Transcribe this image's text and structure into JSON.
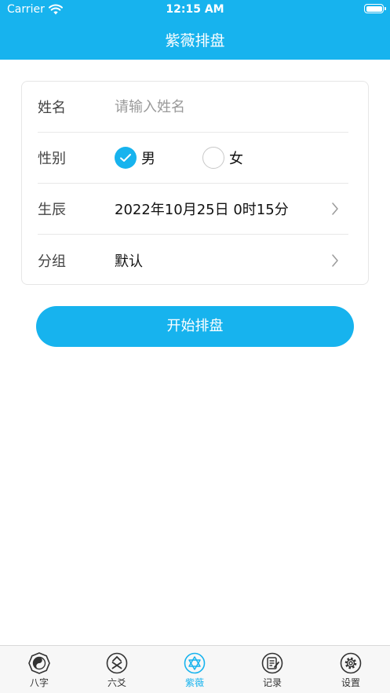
{
  "status_bar": {
    "carrier": "Carrier",
    "time": "12:15 AM"
  },
  "nav": {
    "title": "紫薇排盘"
  },
  "form": {
    "name": {
      "label": "姓名",
      "placeholder": "请输入姓名",
      "value": ""
    },
    "gender": {
      "label": "性别",
      "options": [
        {
          "label": "男",
          "selected": true
        },
        {
          "label": "女",
          "selected": false
        }
      ]
    },
    "birth": {
      "label": "生辰",
      "value": "2022年10月25日 0时15分"
    },
    "group": {
      "label": "分组",
      "value": "默认"
    }
  },
  "start_button": {
    "label": "开始排盘"
  },
  "tabs": [
    {
      "label": "八字",
      "icon": "yin-yang-icon",
      "active": false
    },
    {
      "label": "六爻",
      "icon": "hexagram-lines-icon",
      "active": false
    },
    {
      "label": "紫薇",
      "icon": "star-of-david-icon",
      "active": true
    },
    {
      "label": "记录",
      "icon": "notes-icon",
      "active": false
    },
    {
      "label": "设置",
      "icon": "gear-icon",
      "active": false
    }
  ],
  "colors": {
    "accent": "#17b3ee",
    "tab_inactive": "#333333"
  }
}
